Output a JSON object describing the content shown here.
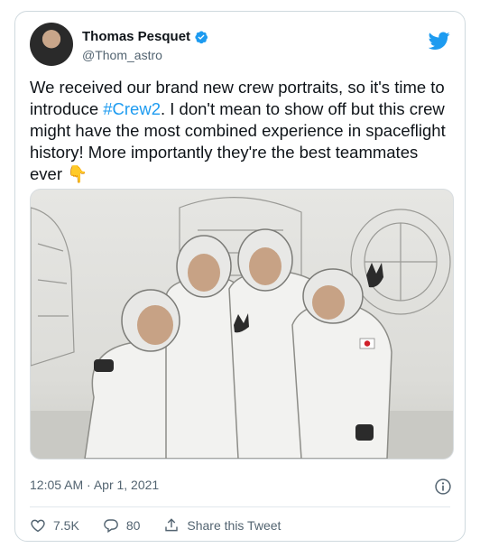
{
  "author": {
    "display_name": "Thomas Pesquet",
    "handle": "@Thom_astro"
  },
  "tweet": {
    "text_before": "We received our brand new crew portraits, so it's time to introduce ",
    "hashtag": "#Crew2",
    "text_after": ". I don't mean to show off but this crew might have the most combined experience in spaceflight history! More importantly they're the best teammates ever ",
    "emoji": "👇",
    "timestamp": "12:05 AM · Apr 1, 2021"
  },
  "actions": {
    "likes": "7.5K",
    "replies": "80",
    "share_label": "Share this Tweet"
  },
  "colors": {
    "accent": "#1d9bf0",
    "text": "#0f1419",
    "secondary": "#536471"
  }
}
